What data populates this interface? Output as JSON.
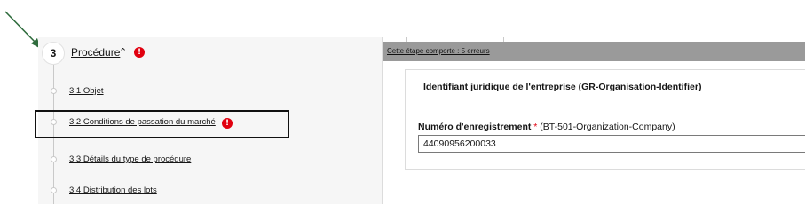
{
  "step": {
    "number": "3",
    "title": "Procédure",
    "chevron_icon": "chevron-up-icon",
    "error_icon": "!"
  },
  "substeps": [
    {
      "label": "3.1 Objet"
    },
    {
      "label": "3.2 Conditions de passation du marché",
      "error_icon": "!"
    },
    {
      "label": "3.3 Détails du type de procédure"
    },
    {
      "label": "3.4 Distribution des lots"
    }
  ],
  "tooltip": {
    "text": "Cette étape comporte : 5 erreurs"
  },
  "card": {
    "title": "Identifiant juridique de l'entreprise (GR-Organisation-Identifier)",
    "field": {
      "label": "Numéro d'enregistrement",
      "required": "*",
      "hint": "(BT-501-Organization-Company)",
      "value": "44090956200033"
    }
  },
  "colors": {
    "error": "#e1000f",
    "annotation_arrow": "#2e6b3c",
    "tooltip_bg": "#9a9a9a"
  }
}
